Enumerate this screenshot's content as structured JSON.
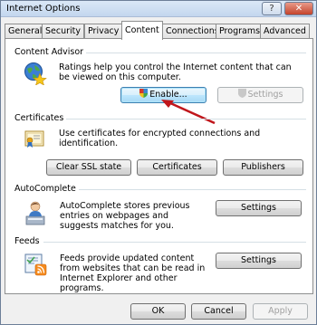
{
  "window": {
    "title": "Internet Options",
    "help_glyph": "?",
    "close_glyph": "✕"
  },
  "tabs": [
    {
      "label": "General"
    },
    {
      "label": "Security"
    },
    {
      "label": "Privacy"
    },
    {
      "label": "Content"
    },
    {
      "label": "Connections"
    },
    {
      "label": "Programs"
    },
    {
      "label": "Advanced"
    }
  ],
  "content_advisor": {
    "heading": "Content Advisor",
    "description": "Ratings help you control the Internet content that can be viewed on this computer.",
    "enable_label": "Enable...",
    "settings_label": "Settings"
  },
  "certificates": {
    "heading": "Certificates",
    "description": "Use certificates for encrypted connections and identification.",
    "clear_ssl_label": "Clear SSL state",
    "certificates_label": "Certificates",
    "publishers_label": "Publishers"
  },
  "autocomplete": {
    "heading": "AutoComplete",
    "description": "AutoComplete stores previous entries on webpages and suggests matches for you.",
    "settings_label": "Settings"
  },
  "feeds": {
    "heading": "Feeds",
    "description": "Feeds provide updated content from websites that can be read in Internet Explorer and other programs.",
    "settings_label": "Settings"
  },
  "footer": {
    "ok_label": "OK",
    "cancel_label": "Cancel",
    "apply_label": "Apply"
  },
  "colors": {
    "arrow": "#c0161b",
    "focus_border": "#3c7fb1"
  }
}
